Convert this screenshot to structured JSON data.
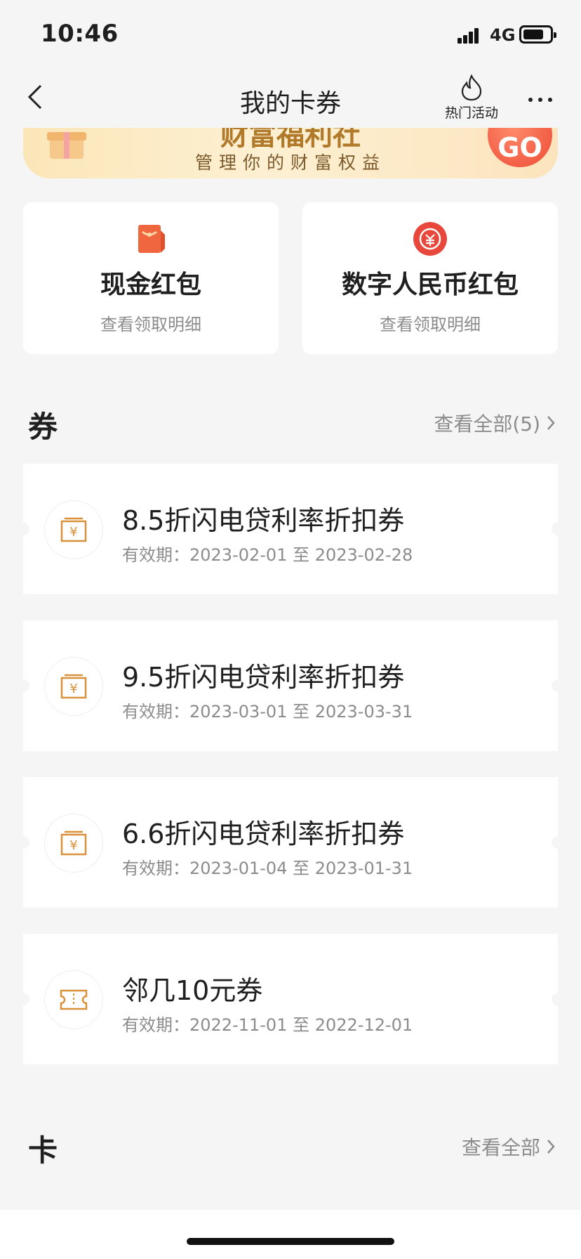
{
  "status_bar": {
    "time": "10:46",
    "network": "4G"
  },
  "nav": {
    "title": "我的卡券",
    "hot_label": "热门活动"
  },
  "banner": {
    "title_partial": "财富福利社",
    "subtitle": "管理你的财富权益",
    "go_label": "GO"
  },
  "entries": [
    {
      "title": "现金红包",
      "subtitle": "查看领取明细",
      "icon": "red-envelope-icon"
    },
    {
      "title": "数字人民币红包",
      "subtitle": "查看领取明细",
      "icon": "digital-rmb-icon"
    }
  ],
  "coupons_section": {
    "title": "券",
    "view_all": "查看全部(5)"
  },
  "coupons": [
    {
      "title": "8.5折闪电贷利率折扣券",
      "validity": "有效期：2023-02-01 至 2023-02-28",
      "icon": "yuan-coupon-icon"
    },
    {
      "title": "9.5折闪电贷利率折扣券",
      "validity": "有效期：2023-03-01 至 2023-03-31",
      "icon": "yuan-coupon-icon"
    },
    {
      "title": "6.6折闪电贷利率折扣券",
      "validity": "有效期：2023-01-04 至 2023-01-31",
      "icon": "yuan-coupon-icon"
    },
    {
      "title": "邻几10元券",
      "validity": "有效期：2022-11-01 至 2022-12-01",
      "icon": "ticket-icon"
    }
  ],
  "cards_section": {
    "title": "卡",
    "view_all": "查看全部"
  },
  "colors": {
    "accent_orange": "#d8913a",
    "go_red": "#ec4b35",
    "muted_text": "#8c8c8c",
    "background": "#f5f5f5"
  }
}
